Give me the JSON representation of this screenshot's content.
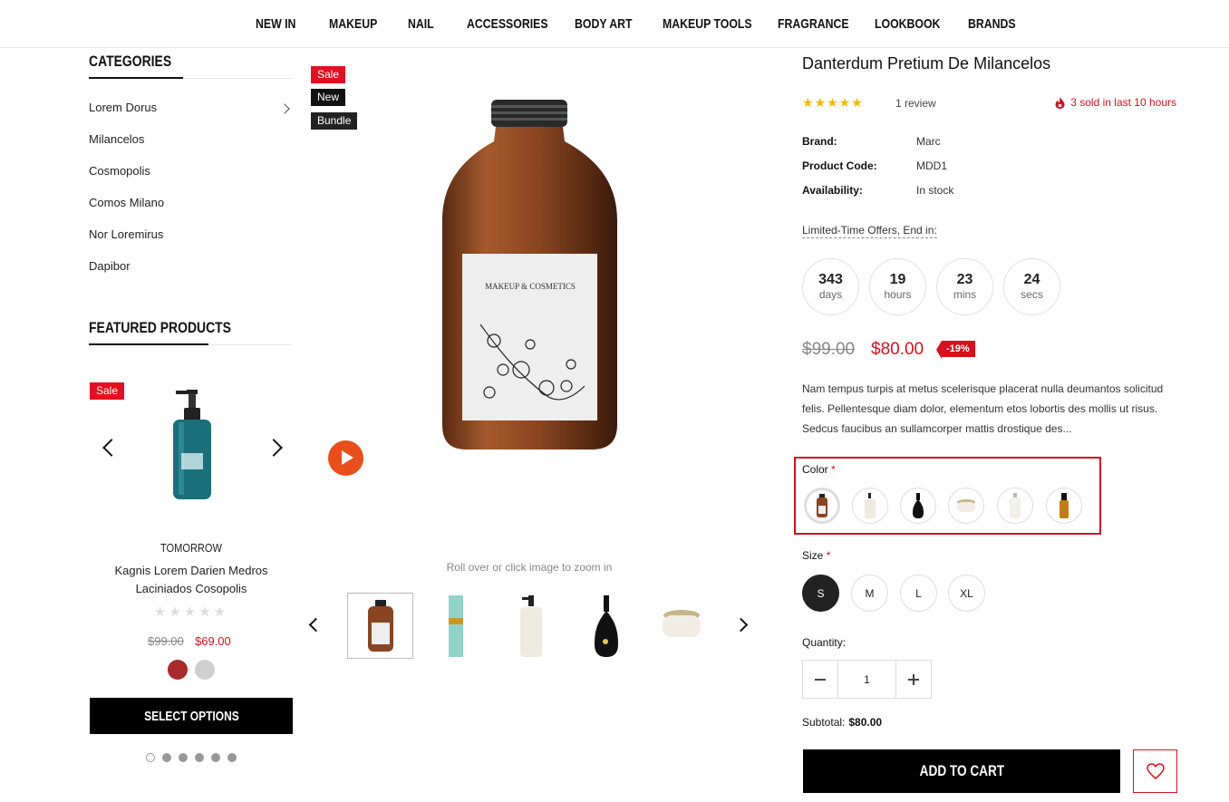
{
  "nav": [
    "NEW IN",
    "MAKEUP",
    "NAIL",
    "ACCESSORIES",
    "BODY ART",
    "MAKEUP TOOLS",
    "FRAGRANCE",
    "LOOKBOOK",
    "BRANDS"
  ],
  "sidebar": {
    "categories_title": "CATEGORIES",
    "categories": [
      "Lorem Dorus",
      "Milancelos",
      "Cosmopolis",
      "Comos Milano",
      "Nor Loremirus",
      "Dapibor"
    ],
    "featured_title": "FEATURED PRODUCTS",
    "featured": {
      "badge": "Sale",
      "brand": "TOMORROW",
      "name_line1": "Kagnis Lorem Darien Medros",
      "name_line2": "Laciniados Cosopolis",
      "old_price": "$99.00",
      "price": "$69.00",
      "swatch_colors": [
        "#a82a2a",
        "#cfcfcf"
      ],
      "button": "SELECT OPTIONS",
      "rating": 0,
      "dots": 6
    }
  },
  "gallery": {
    "badges": [
      "Sale",
      "New",
      "Bundle"
    ],
    "label_text": "MAKEUP & COSMETICS",
    "zoom_hint": "Roll over or click image to zoom in"
  },
  "product": {
    "title": "Danterdum Pretium De Milancelos",
    "stars": "★★★★★",
    "reviews": "1 review",
    "sold": "3 sold in last 10 hours",
    "brand_label": "Brand:",
    "brand": "Marc",
    "code_label": "Product Code:",
    "code": "MDD1",
    "avail_label": "Availability:",
    "availability": "In stock",
    "offer_text": "Limited-Time Offers, End in:",
    "countdown": [
      {
        "n": "343",
        "u": "days"
      },
      {
        "n": "19",
        "u": "hours"
      },
      {
        "n": "23",
        "u": "mins"
      },
      {
        "n": "24",
        "u": "secs"
      }
    ],
    "old_price": "$99.00",
    "price": "$80.00",
    "discount": "-19%",
    "description": "Nam tempus turpis at metus scelerisque placerat nulla deumantos solicitud felis. Pellentesque diam dolor, elementum etos lobortis des mollis ut risus. Sedcus faucibus an sullamcorper mattis drostique des...",
    "color_label": "Color",
    "size_label": "Size",
    "required_mark": "*",
    "sizes": [
      "S",
      "M",
      "L",
      "XL"
    ],
    "quantity_label": "Quantity:",
    "quantity": "1",
    "subtotal_label": "Subtotal:",
    "subtotal": "$80.00",
    "add_to_cart": "ADD TO CART",
    "accent": "#d6101e"
  }
}
